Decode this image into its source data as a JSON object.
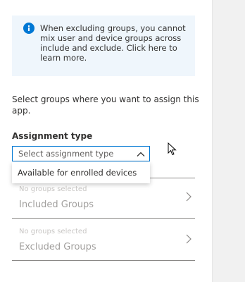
{
  "info": {
    "message": "When excluding groups, you cannot mix user and device groups across include and exclude.  Click here to learn more.",
    "icon": "info-icon",
    "accent": "#0078d4",
    "background": "#eff6fc"
  },
  "assign": {
    "help_text": "Select groups where you want to assign this app.",
    "type_label": "Assignment type",
    "dropdown_value": "Select assignment type",
    "dropdown_options": [
      "Available for enrolled devices"
    ]
  },
  "groups": {
    "included": {
      "sub": "No groups selected",
      "title": "Included Groups"
    },
    "excluded": {
      "sub": "No groups selected",
      "title": "Excluded Groups"
    }
  }
}
